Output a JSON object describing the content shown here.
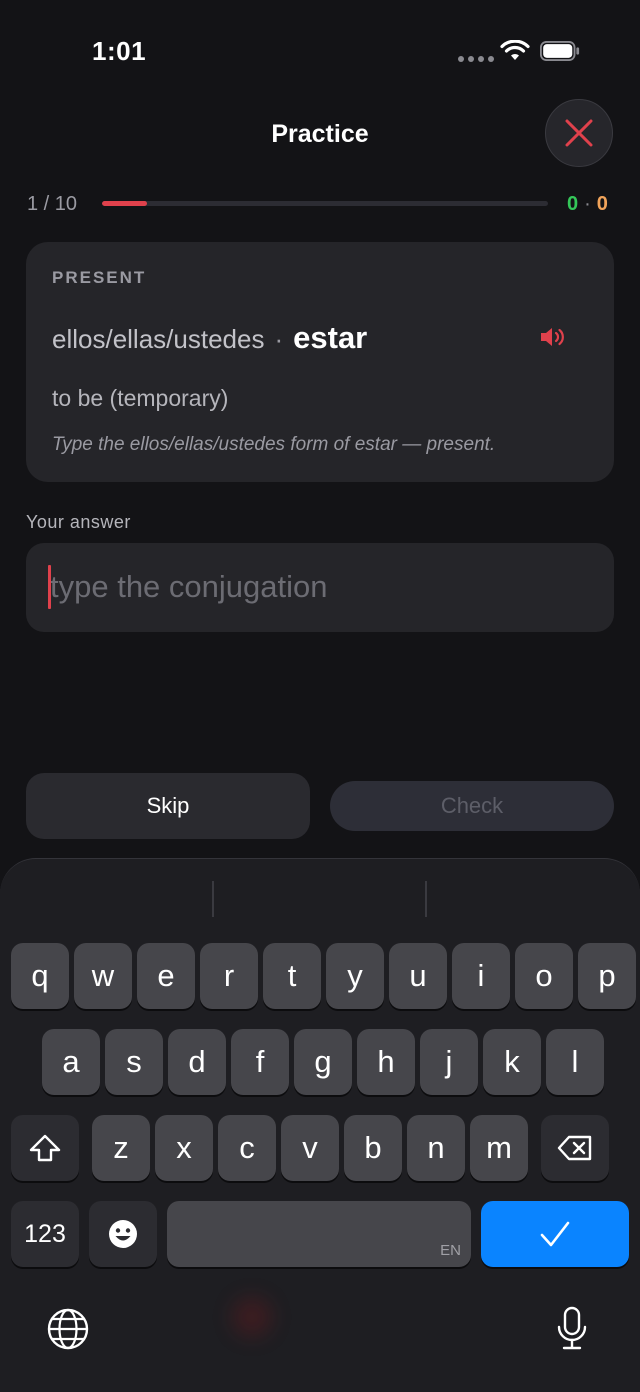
{
  "status_bar": {
    "time": "1:01"
  },
  "header": {
    "title": "Practice",
    "close_icon": "close-icon"
  },
  "progress": {
    "label": "1 / 10",
    "fraction": 0.1,
    "correct": "0",
    "separator": "·",
    "wrong": "0"
  },
  "card": {
    "tense": "PRESENT",
    "pronoun": "ellos/ellas/ustedes",
    "separator": "·",
    "verb": "estar",
    "meaning": "to be (temporary)",
    "instruction": "Type the ellos/ellas/ustedes form of estar — present.",
    "speaker_icon": "speaker-icon"
  },
  "answer": {
    "label": "Your answer",
    "placeholder": "type the conjugation",
    "value": ""
  },
  "buttons": {
    "skip": "Skip",
    "check": "Check"
  },
  "keyboard": {
    "row1": [
      "q",
      "w",
      "e",
      "r",
      "t",
      "y",
      "u",
      "i",
      "o",
      "p"
    ],
    "row2": [
      "a",
      "s",
      "d",
      "f",
      "g",
      "h",
      "j",
      "k",
      "l"
    ],
    "row3": [
      "z",
      "x",
      "c",
      "v",
      "b",
      "n",
      "m"
    ],
    "numbers_label": "123",
    "space_lang": "EN",
    "icons": [
      "shift-icon",
      "delete-icon",
      "emoji-icon",
      "checkmark-icon",
      "globe-icon",
      "microphone-icon"
    ]
  },
  "colors": {
    "accent_red": "#e0414c",
    "correct_green": "#34c759",
    "wrong_orange": "#f0a35a",
    "keyboard_blue": "#0a84ff"
  }
}
